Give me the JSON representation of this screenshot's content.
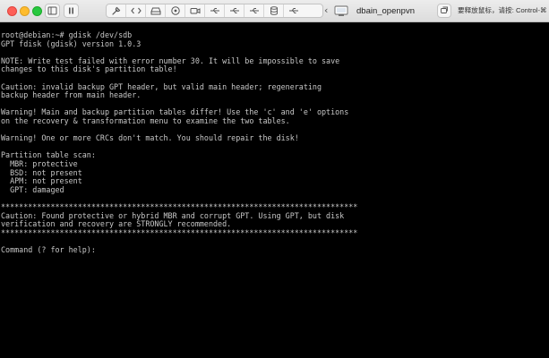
{
  "window": {
    "title": "dbain_openpvn",
    "hint": "要释放鼠标，请按: Control-⌘"
  },
  "toolbar": {
    "icons": [
      "wrench-icon",
      "code-icon",
      "drive-icon",
      "audio-icon",
      "camera-icon",
      "usb-icon",
      "usb-icon",
      "usb-icon",
      "database-icon",
      "usb-icon"
    ]
  },
  "terminal": {
    "lines": [
      "root@debian:~# gdisk /dev/sdb",
      "GPT fdisk (gdisk) version 1.0.3",
      "",
      "NOTE: Write test failed with error number 30. It will be impossible to save",
      "changes to this disk's partition table!",
      "",
      "Caution: invalid backup GPT header, but valid main header; regenerating",
      "backup header from main header.",
      "",
      "Warning! Main and backup partition tables differ! Use the 'c' and 'e' options",
      "on the recovery & transformation menu to examine the two tables.",
      "",
      "Warning! One or more CRCs don't match. You should repair the disk!",
      "",
      "Partition table scan:",
      "  MBR: protective",
      "  BSD: not present",
      "  APM: not present",
      "  GPT: damaged",
      "",
      "*******************************************************************************",
      "Caution: Found protective or hybrid MBR and corrupt GPT. Using GPT, but disk",
      "verification and recovery are STRONGLY recommended.",
      "*******************************************************************************",
      "",
      "Command (? for help):"
    ]
  },
  "colors": {
    "terminal_bg": "#000000",
    "terminal_fg": "#c8c8c8",
    "titlebar_bg": "#e4e4e4"
  }
}
